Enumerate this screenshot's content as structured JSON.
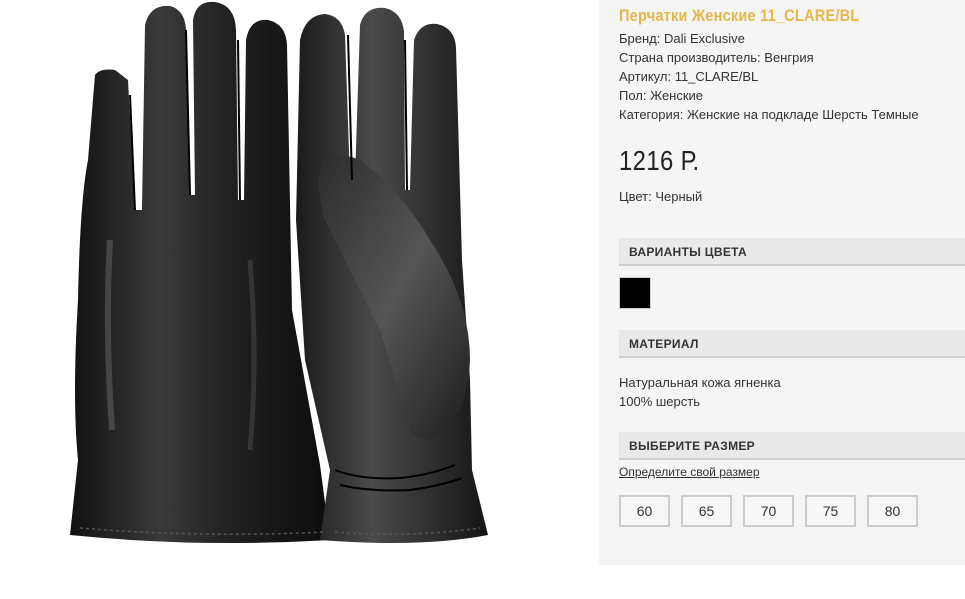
{
  "product": {
    "title": "Перчатки Женские 11_CLARE/BL",
    "specs": [
      "Бренд: Dali Exclusive",
      "Страна производитель: Венгрия",
      "Артикул: 11_CLARE/BL",
      "Пол: Женские",
      "Категория: Женские на подкладе Шерсть Темные"
    ],
    "price": "1216 Р.",
    "color_label": "Цвет: Черный",
    "image_icon": "leather-gloves-photo"
  },
  "sections": {
    "color_variants": "ВАРИАНТЫ ЦВЕТА",
    "material": "МАТЕРИАЛ",
    "size": "ВЫБЕРИТЕ РАЗМЕР"
  },
  "color_swatches": [
    {
      "name": "Черный",
      "color": "#000000"
    }
  ],
  "material_lines": [
    "Натуральная кожа ягненка",
    "100% шерсть"
  ],
  "size_link": "Определите свой размер",
  "sizes": [
    "60",
    "65",
    "70",
    "75",
    "80"
  ],
  "colors": {
    "title": "#e5b64a",
    "panel_bg": "#f5f5f5",
    "section_bg": "#e9e9e9"
  }
}
